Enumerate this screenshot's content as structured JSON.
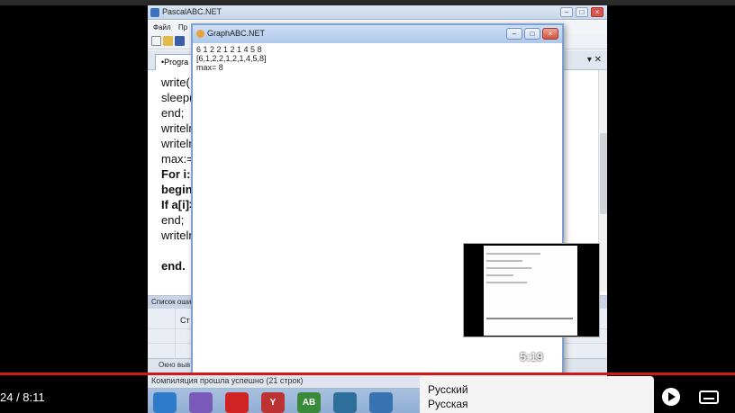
{
  "pascal": {
    "title": "PascalABC.NET",
    "menu": [
      "Файл",
      "Пр"
    ],
    "tab_label": "•Progra",
    "tab_controls": "▾ ✕",
    "code_lines": [
      {
        "text": "write(",
        "bold": false
      },
      {
        "text": "sleep(",
        "bold": false
      },
      {
        "text": "end;",
        "bold": false
      },
      {
        "text": "writeln",
        "bold": false
      },
      {
        "text": "writeln",
        "bold": false
      },
      {
        "text": "max:=",
        "bold": false
      },
      {
        "text": "For i:=",
        "bold": true
      },
      {
        "text": "begin",
        "bold": true
      },
      {
        "text": "If a[i]>",
        "bold": true
      },
      {
        "text": "end;",
        "bold": false
      },
      {
        "text": "writeln",
        "bold": false
      },
      {
        "text": "",
        "bold": false
      },
      {
        "text": "end.",
        "bold": true
      }
    ],
    "error_panel_title": "Список оши",
    "error_col_label": "Ст",
    "output_label": "Окно выв",
    "status_text": "Компиляция прошла успешно (21 строк)"
  },
  "graph_window": {
    "title": "GraphABC.NET",
    "lines": [
      "6 1 2 2 1 2 1 4 5 8",
      "[6,1,2,2,1,2,1,4,5,8]",
      "max= 8"
    ]
  },
  "taskbar_apps": [
    {
      "name": "windows-start-icon",
      "label": "",
      "color": "#2f7bc9"
    },
    {
      "name": "drop-icon",
      "label": "",
      "color": "#7a5ab8"
    },
    {
      "name": "opera-icon",
      "label": "",
      "color": "#d02424"
    },
    {
      "name": "yandex-icon",
      "label": "Y",
      "color": "#b33"
    },
    {
      "name": "abc-icon",
      "label": "AB",
      "color": "#3a8a3a"
    },
    {
      "name": "clock-icon",
      "label": "",
      "color": "#2d6e9a"
    },
    {
      "name": "folder-icon",
      "label": "",
      "color": "#3872b0"
    }
  ],
  "youtube": {
    "time": "24 / 8:11",
    "preview_time": "5:19",
    "language_options": [
      "Русский",
      "Русская"
    ]
  }
}
